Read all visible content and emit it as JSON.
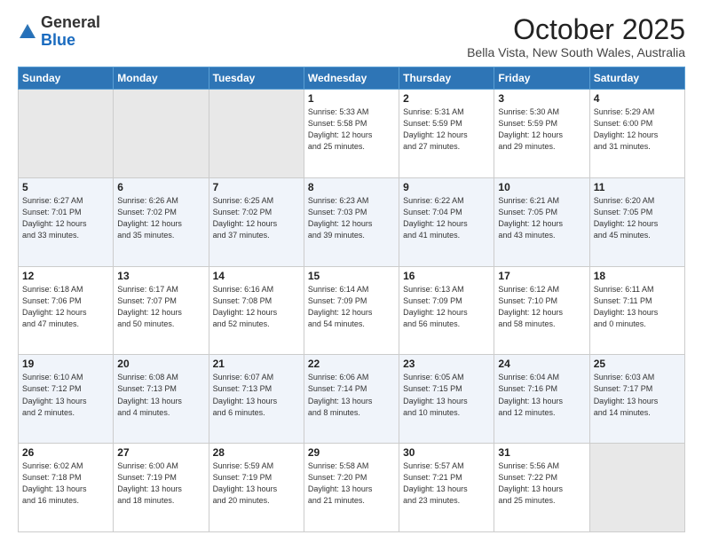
{
  "logo": {
    "general": "General",
    "blue": "Blue"
  },
  "header": {
    "month": "October 2025",
    "location": "Bella Vista, New South Wales, Australia"
  },
  "weekdays": [
    "Sunday",
    "Monday",
    "Tuesday",
    "Wednesday",
    "Thursday",
    "Friday",
    "Saturday"
  ],
  "weeks": [
    [
      {
        "day": "",
        "info": ""
      },
      {
        "day": "",
        "info": ""
      },
      {
        "day": "",
        "info": ""
      },
      {
        "day": "1",
        "info": "Sunrise: 5:33 AM\nSunset: 5:58 PM\nDaylight: 12 hours\nand 25 minutes."
      },
      {
        "day": "2",
        "info": "Sunrise: 5:31 AM\nSunset: 5:59 PM\nDaylight: 12 hours\nand 27 minutes."
      },
      {
        "day": "3",
        "info": "Sunrise: 5:30 AM\nSunset: 5:59 PM\nDaylight: 12 hours\nand 29 minutes."
      },
      {
        "day": "4",
        "info": "Sunrise: 5:29 AM\nSunset: 6:00 PM\nDaylight: 12 hours\nand 31 minutes."
      }
    ],
    [
      {
        "day": "5",
        "info": "Sunrise: 6:27 AM\nSunset: 7:01 PM\nDaylight: 12 hours\nand 33 minutes."
      },
      {
        "day": "6",
        "info": "Sunrise: 6:26 AM\nSunset: 7:02 PM\nDaylight: 12 hours\nand 35 minutes."
      },
      {
        "day": "7",
        "info": "Sunrise: 6:25 AM\nSunset: 7:02 PM\nDaylight: 12 hours\nand 37 minutes."
      },
      {
        "day": "8",
        "info": "Sunrise: 6:23 AM\nSunset: 7:03 PM\nDaylight: 12 hours\nand 39 minutes."
      },
      {
        "day": "9",
        "info": "Sunrise: 6:22 AM\nSunset: 7:04 PM\nDaylight: 12 hours\nand 41 minutes."
      },
      {
        "day": "10",
        "info": "Sunrise: 6:21 AM\nSunset: 7:05 PM\nDaylight: 12 hours\nand 43 minutes."
      },
      {
        "day": "11",
        "info": "Sunrise: 6:20 AM\nSunset: 7:05 PM\nDaylight: 12 hours\nand 45 minutes."
      }
    ],
    [
      {
        "day": "12",
        "info": "Sunrise: 6:18 AM\nSunset: 7:06 PM\nDaylight: 12 hours\nand 47 minutes."
      },
      {
        "day": "13",
        "info": "Sunrise: 6:17 AM\nSunset: 7:07 PM\nDaylight: 12 hours\nand 50 minutes."
      },
      {
        "day": "14",
        "info": "Sunrise: 6:16 AM\nSunset: 7:08 PM\nDaylight: 12 hours\nand 52 minutes."
      },
      {
        "day": "15",
        "info": "Sunrise: 6:14 AM\nSunset: 7:09 PM\nDaylight: 12 hours\nand 54 minutes."
      },
      {
        "day": "16",
        "info": "Sunrise: 6:13 AM\nSunset: 7:09 PM\nDaylight: 12 hours\nand 56 minutes."
      },
      {
        "day": "17",
        "info": "Sunrise: 6:12 AM\nSunset: 7:10 PM\nDaylight: 12 hours\nand 58 minutes."
      },
      {
        "day": "18",
        "info": "Sunrise: 6:11 AM\nSunset: 7:11 PM\nDaylight: 13 hours\nand 0 minutes."
      }
    ],
    [
      {
        "day": "19",
        "info": "Sunrise: 6:10 AM\nSunset: 7:12 PM\nDaylight: 13 hours\nand 2 minutes."
      },
      {
        "day": "20",
        "info": "Sunrise: 6:08 AM\nSunset: 7:13 PM\nDaylight: 13 hours\nand 4 minutes."
      },
      {
        "day": "21",
        "info": "Sunrise: 6:07 AM\nSunset: 7:13 PM\nDaylight: 13 hours\nand 6 minutes."
      },
      {
        "day": "22",
        "info": "Sunrise: 6:06 AM\nSunset: 7:14 PM\nDaylight: 13 hours\nand 8 minutes."
      },
      {
        "day": "23",
        "info": "Sunrise: 6:05 AM\nSunset: 7:15 PM\nDaylight: 13 hours\nand 10 minutes."
      },
      {
        "day": "24",
        "info": "Sunrise: 6:04 AM\nSunset: 7:16 PM\nDaylight: 13 hours\nand 12 minutes."
      },
      {
        "day": "25",
        "info": "Sunrise: 6:03 AM\nSunset: 7:17 PM\nDaylight: 13 hours\nand 14 minutes."
      }
    ],
    [
      {
        "day": "26",
        "info": "Sunrise: 6:02 AM\nSunset: 7:18 PM\nDaylight: 13 hours\nand 16 minutes."
      },
      {
        "day": "27",
        "info": "Sunrise: 6:00 AM\nSunset: 7:19 PM\nDaylight: 13 hours\nand 18 minutes."
      },
      {
        "day": "28",
        "info": "Sunrise: 5:59 AM\nSunset: 7:19 PM\nDaylight: 13 hours\nand 20 minutes."
      },
      {
        "day": "29",
        "info": "Sunrise: 5:58 AM\nSunset: 7:20 PM\nDaylight: 13 hours\nand 21 minutes."
      },
      {
        "day": "30",
        "info": "Sunrise: 5:57 AM\nSunset: 7:21 PM\nDaylight: 13 hours\nand 23 minutes."
      },
      {
        "day": "31",
        "info": "Sunrise: 5:56 AM\nSunset: 7:22 PM\nDaylight: 13 hours\nand 25 minutes."
      },
      {
        "day": "",
        "info": ""
      }
    ]
  ]
}
